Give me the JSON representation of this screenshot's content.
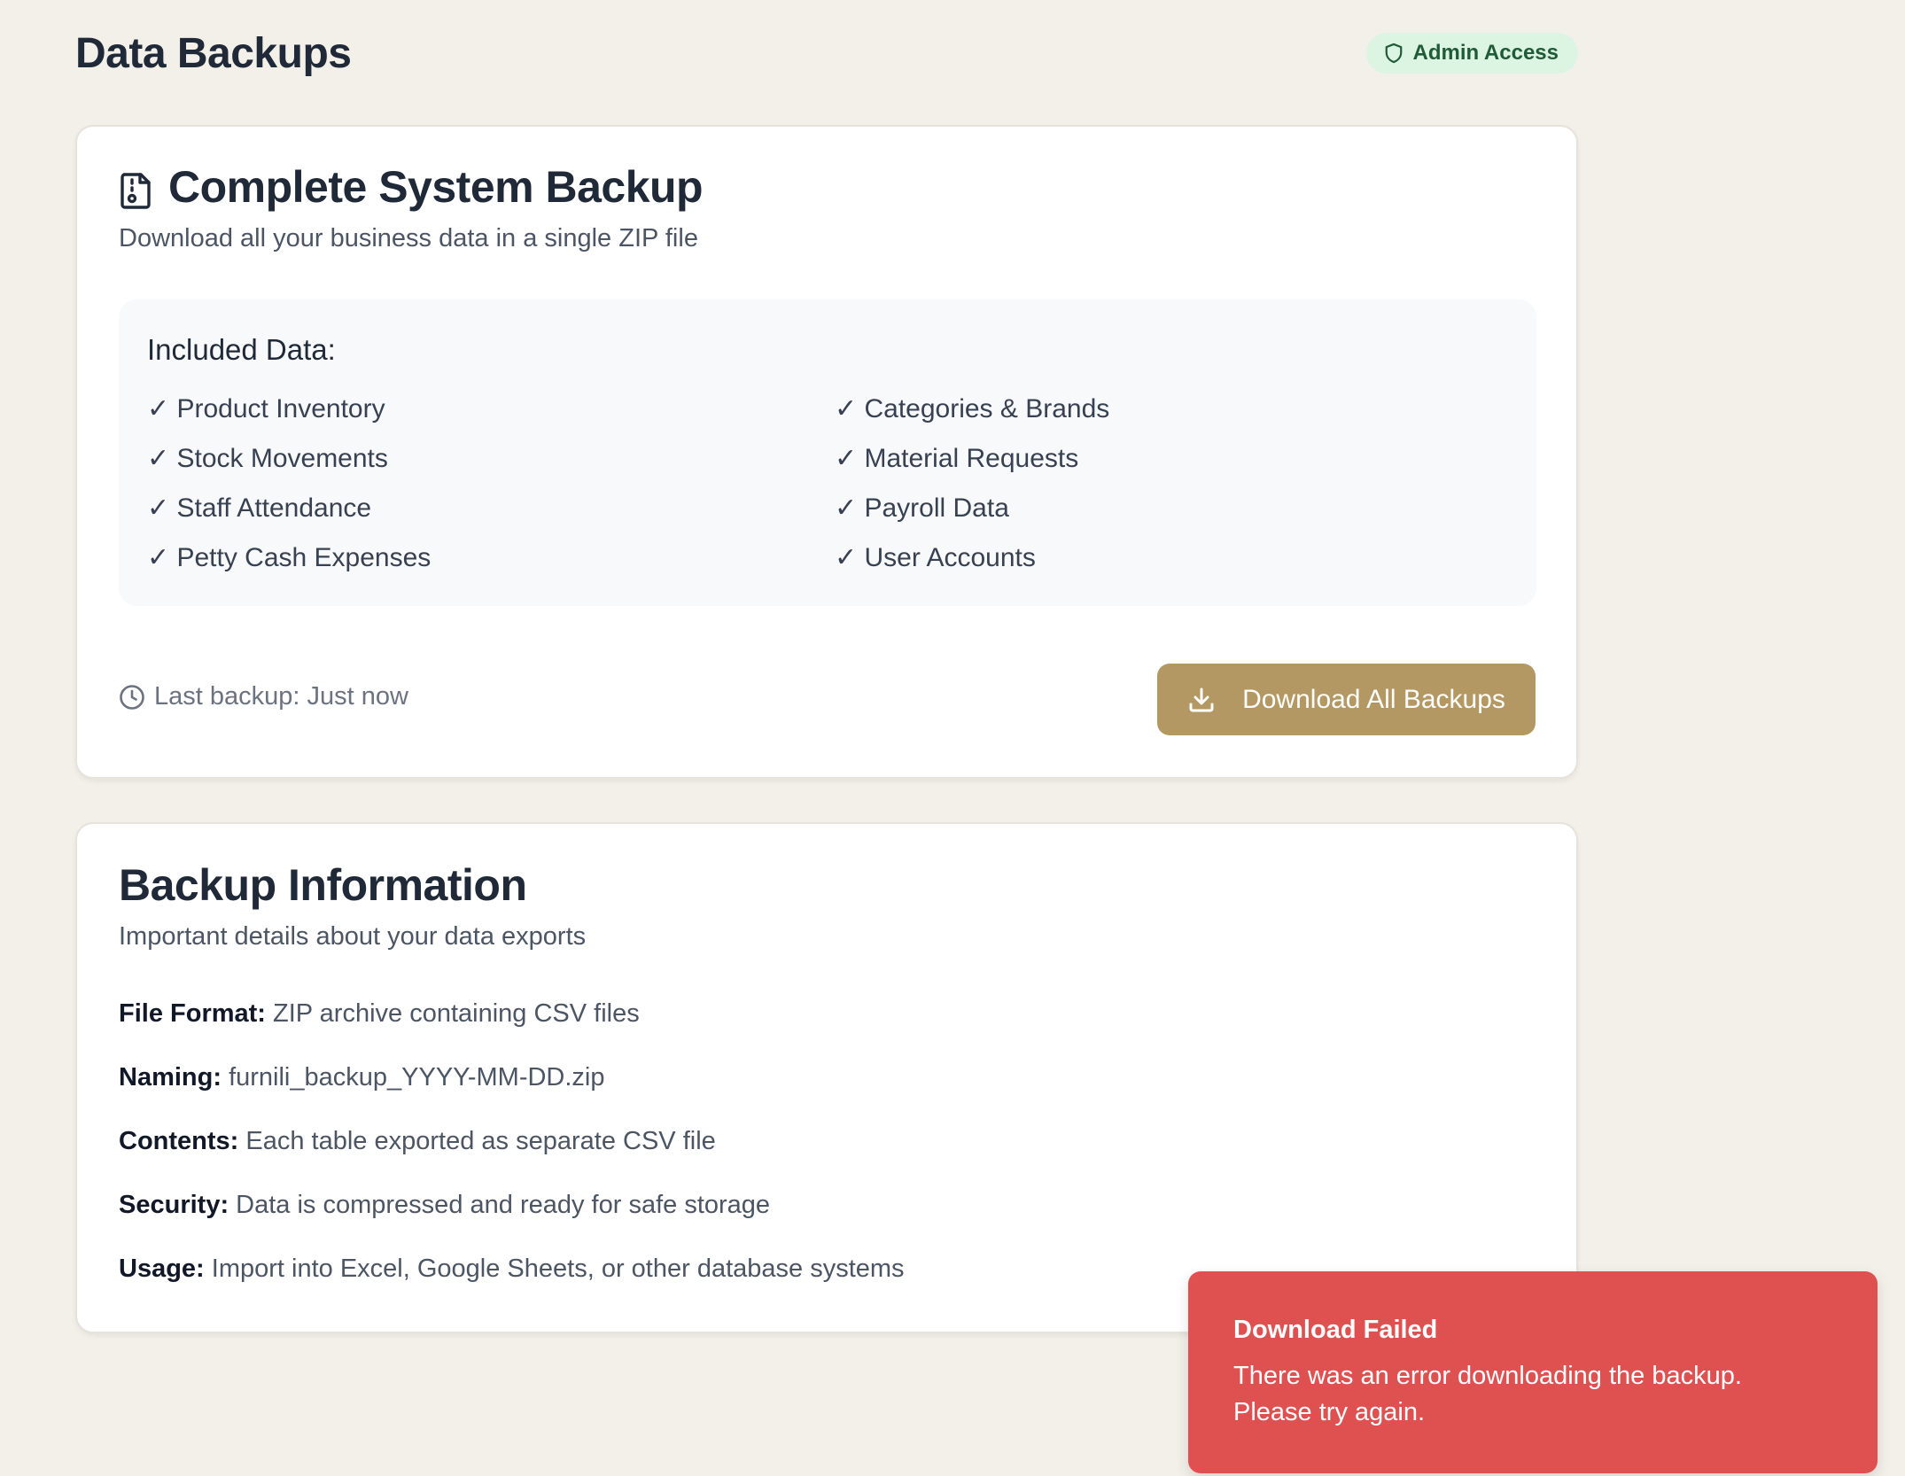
{
  "page": {
    "title": "Data Backups",
    "badge": "Admin Access"
  },
  "backup_card": {
    "title": "Complete System Backup",
    "subtitle": "Download all your business data in a single ZIP file",
    "included_title": "Included Data:",
    "items": [
      "✓ Product Inventory",
      "✓ Categories & Brands",
      "✓ Stock Movements",
      "✓ Material Requests",
      "✓ Staff Attendance",
      "✓ Payroll Data",
      "✓ Petty Cash Expenses",
      "✓ User Accounts"
    ],
    "last_backup": "Last backup: Just now",
    "download_label": "Download All Backups"
  },
  "info_card": {
    "title": "Backup Information",
    "subtitle": "Important details about your data exports",
    "rows": [
      {
        "key": "File Format:",
        "value": "ZIP archive containing CSV files"
      },
      {
        "key": "Naming:",
        "value": "furnili_backup_YYYY-MM-DD.zip"
      },
      {
        "key": "Contents:",
        "value": "Each table exported as separate CSV file"
      },
      {
        "key": "Security:",
        "value": "Data is compressed and ready for safe storage"
      },
      {
        "key": "Usage:",
        "value": "Import into Excel, Google Sheets, or other database systems"
      }
    ]
  },
  "toast": {
    "title": "Download Failed",
    "message": "There was an error downloading the backup. Please try again."
  },
  "colors": {
    "background": "#f3efe9",
    "accent": "#b49863",
    "badge_bg": "#dcf5e3",
    "badge_text": "#1e5b36",
    "error": "#df5050"
  },
  "icons": {
    "badge": "shield-icon",
    "card_title": "file-archive-icon",
    "last_backup": "clock-icon",
    "download": "download-icon"
  }
}
